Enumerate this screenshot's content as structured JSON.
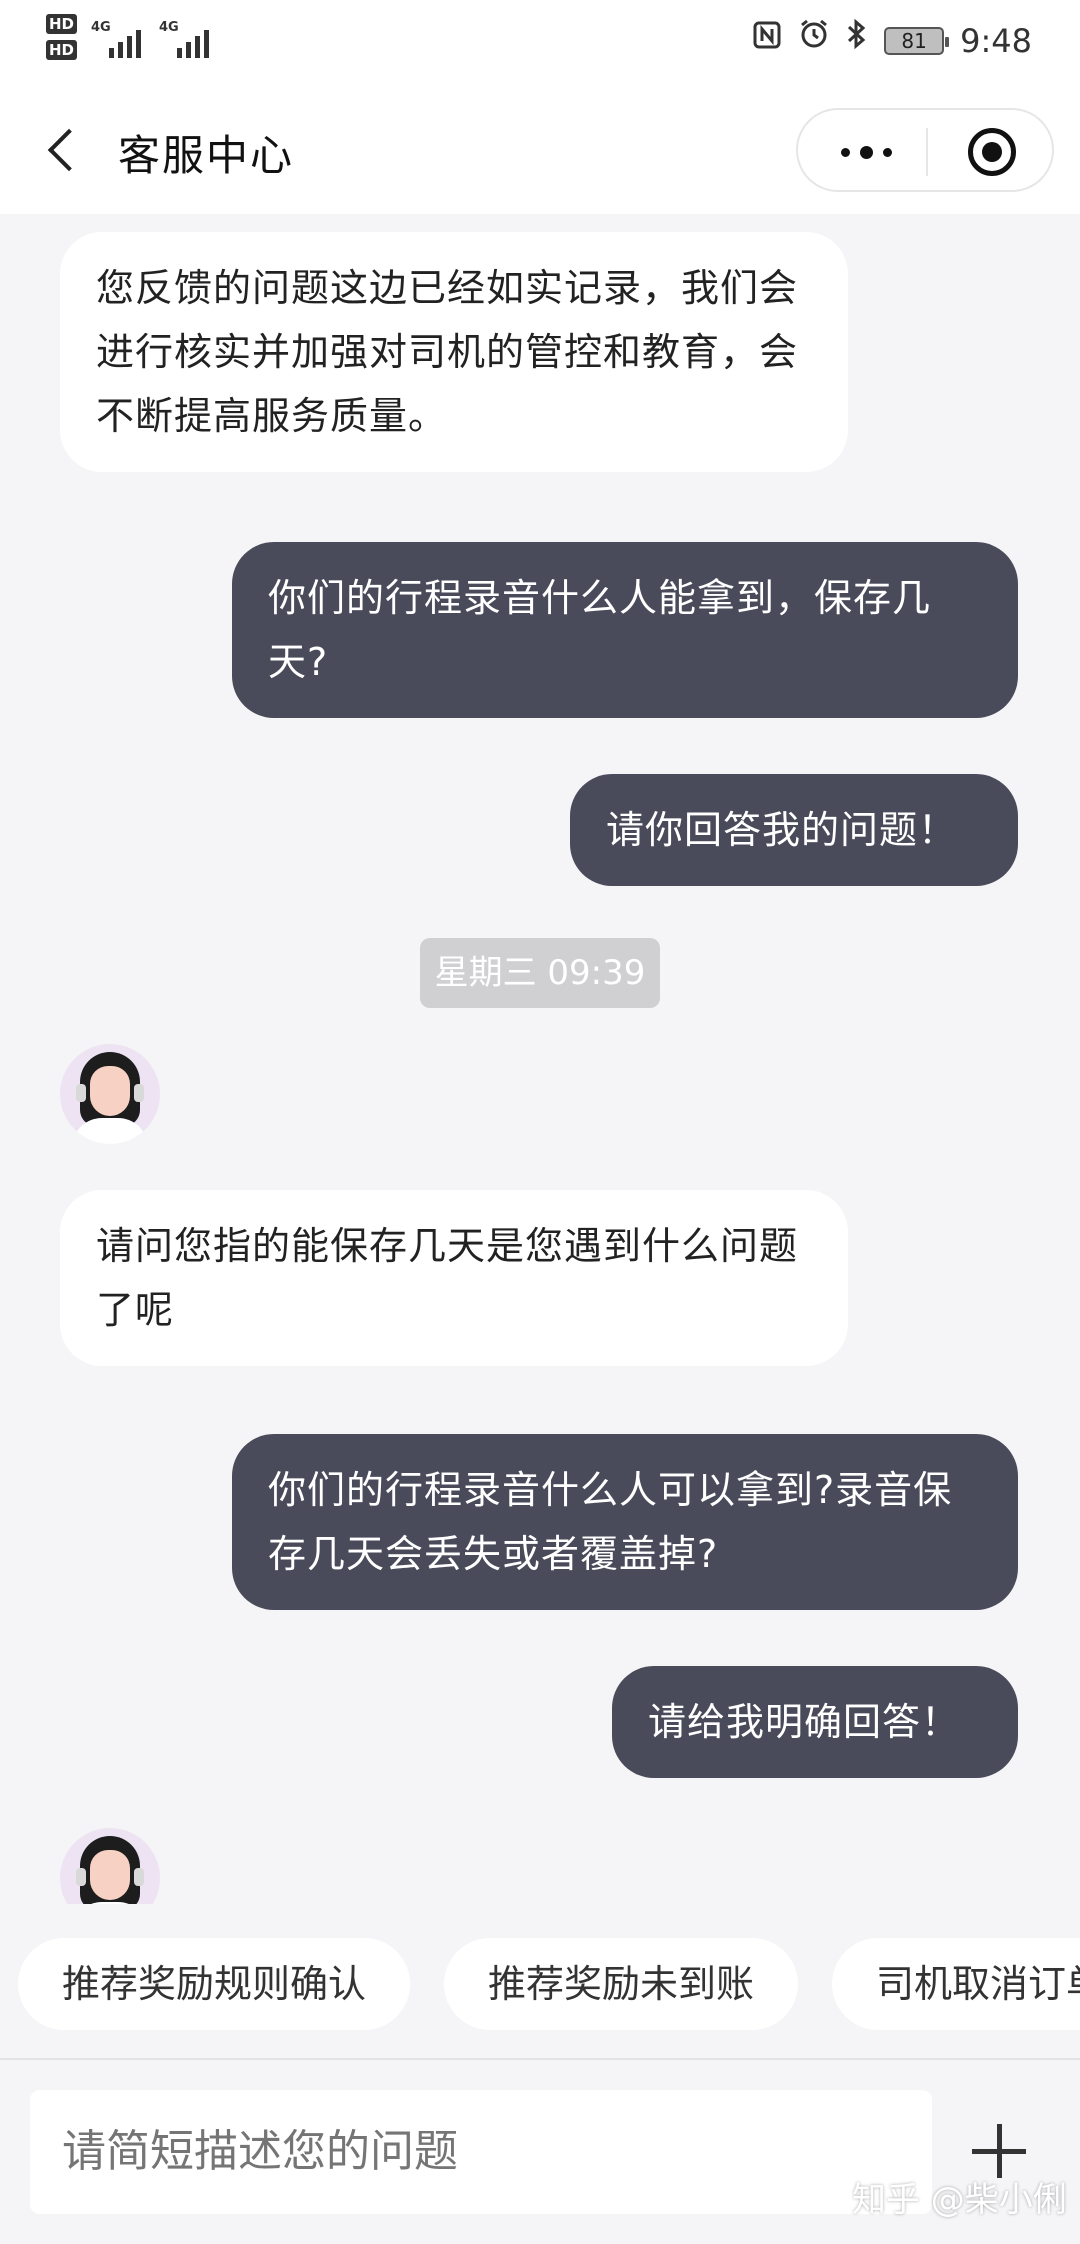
{
  "status_bar": {
    "hd1": "HD",
    "hd2": "HD",
    "sim1_gen": "4G",
    "sim2_gen": "4G",
    "battery": "81",
    "time": "9:48",
    "icons": [
      "nfc-icon",
      "alarm-icon",
      "bluetooth-icon"
    ]
  },
  "nav": {
    "title": "客服中心"
  },
  "messages": [
    {
      "side": "left",
      "text": "您反馈的问题这边已经如实记录，我们会进行核实并加强对司机的管控和教育，会不断提高服务质量。"
    },
    {
      "side": "right",
      "text": "你们的行程录音什么人能拿到，保存几天?"
    },
    {
      "side": "right",
      "text": "请你回答我的问题！"
    },
    {
      "side": "left",
      "text": "请问您指的能保存几天是您遇到什么问题了呢"
    },
    {
      "side": "right",
      "text": "你们的行程录音什么人可以拿到?录音保存几天会丢失或者覆盖掉?"
    },
    {
      "side": "right",
      "text": "请给我明确回答！"
    }
  ],
  "timestamp": "星期三 09:39",
  "quick_replies": [
    "推荐奖励规则确认",
    "推荐奖励未到账",
    "司机取消订单"
  ],
  "input": {
    "placeholder": "请简短描述您的问题"
  },
  "watermark": "知乎 @柴小俐",
  "colors": {
    "user_bubble": "#4a4b5a",
    "agent_bubble": "#ffffff",
    "background": "#f5f5f7"
  }
}
